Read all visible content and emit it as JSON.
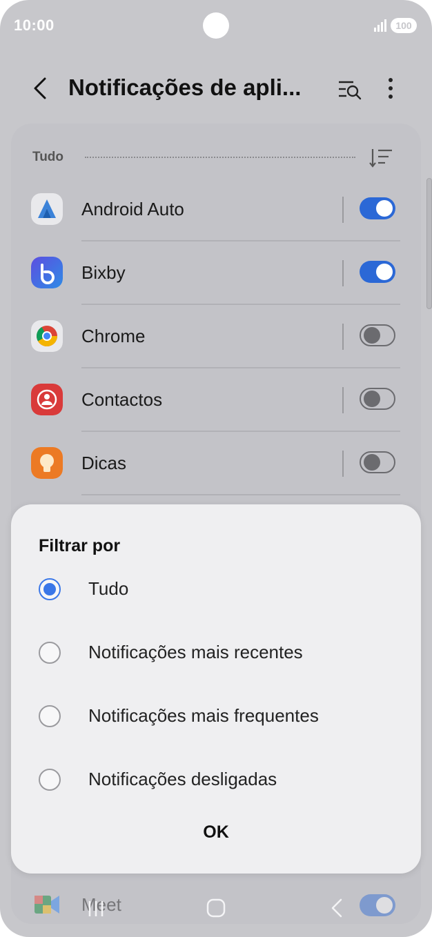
{
  "status": {
    "time": "10:00",
    "battery": "100"
  },
  "header": {
    "title": "Notificações de apli..."
  },
  "list": {
    "section": "Tudo",
    "apps": [
      {
        "label": "Android Auto",
        "enabled": true
      },
      {
        "label": "Bixby",
        "enabled": true
      },
      {
        "label": "Chrome",
        "enabled": false
      },
      {
        "label": "Contactos",
        "enabled": false
      },
      {
        "label": "Dicas",
        "enabled": false
      }
    ],
    "partial_app": {
      "label": "Meet",
      "enabled": true
    }
  },
  "dialog": {
    "title": "Filtrar por",
    "options": [
      {
        "label": "Tudo",
        "selected": true
      },
      {
        "label": "Notificações mais recentes",
        "selected": false
      },
      {
        "label": "Notificações mais frequentes",
        "selected": false
      },
      {
        "label": "Notificações desligadas",
        "selected": false
      }
    ],
    "ok_label": "OK"
  },
  "colors": {
    "accent": "#3a77e8",
    "toggle_on": "#2b68d6",
    "scrim": "#c7c7cb"
  }
}
